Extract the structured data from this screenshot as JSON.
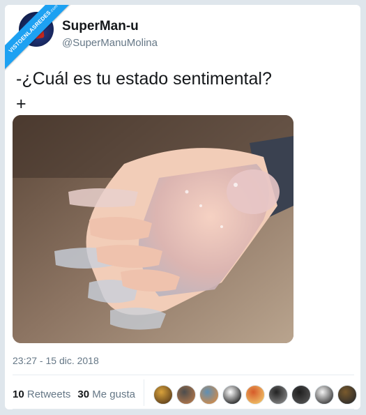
{
  "watermark": {
    "line1": "VISTOENLASREDES",
    "line2": ".com"
  },
  "author": {
    "display_name": "SuperMan-u",
    "handle": "@SuperManuMolina"
  },
  "tweet": {
    "text": "-¿Cuál es tu estado sentimental?\n+",
    "timestamp": "23:27 - 15 dic. 2018"
  },
  "stats": {
    "retweets_count": "10",
    "retweets_label": "Retweets",
    "likes_count": "30",
    "likes_label": "Me gusta"
  },
  "likers": [
    {
      "name": "liker-avatar-1",
      "colors": [
        "#d8a23c",
        "#5a3c1a"
      ]
    },
    {
      "name": "liker-avatar-2",
      "colors": [
        "#4d4d4d",
        "#b3784b"
      ]
    },
    {
      "name": "liker-avatar-3",
      "colors": [
        "#5f8fb4",
        "#d38a46"
      ]
    },
    {
      "name": "liker-avatar-4",
      "colors": [
        "#ffffff",
        "#1a1a1a"
      ]
    },
    {
      "name": "liker-avatar-5",
      "colors": [
        "#d65b2a",
        "#f0c46a"
      ]
    },
    {
      "name": "liker-avatar-6",
      "colors": [
        "#222222",
        "#888888"
      ]
    },
    {
      "name": "liker-avatar-7",
      "colors": [
        "#1e1e1e",
        "#555555"
      ]
    },
    {
      "name": "liker-avatar-8",
      "colors": [
        "#f4f4f4",
        "#333333"
      ]
    },
    {
      "name": "liker-avatar-9",
      "colors": [
        "#7a5a2d",
        "#2b2b2b"
      ]
    }
  ],
  "colors": {
    "accent": "#1da1f2",
    "text": "#14171a",
    "secondary": "#657786"
  }
}
